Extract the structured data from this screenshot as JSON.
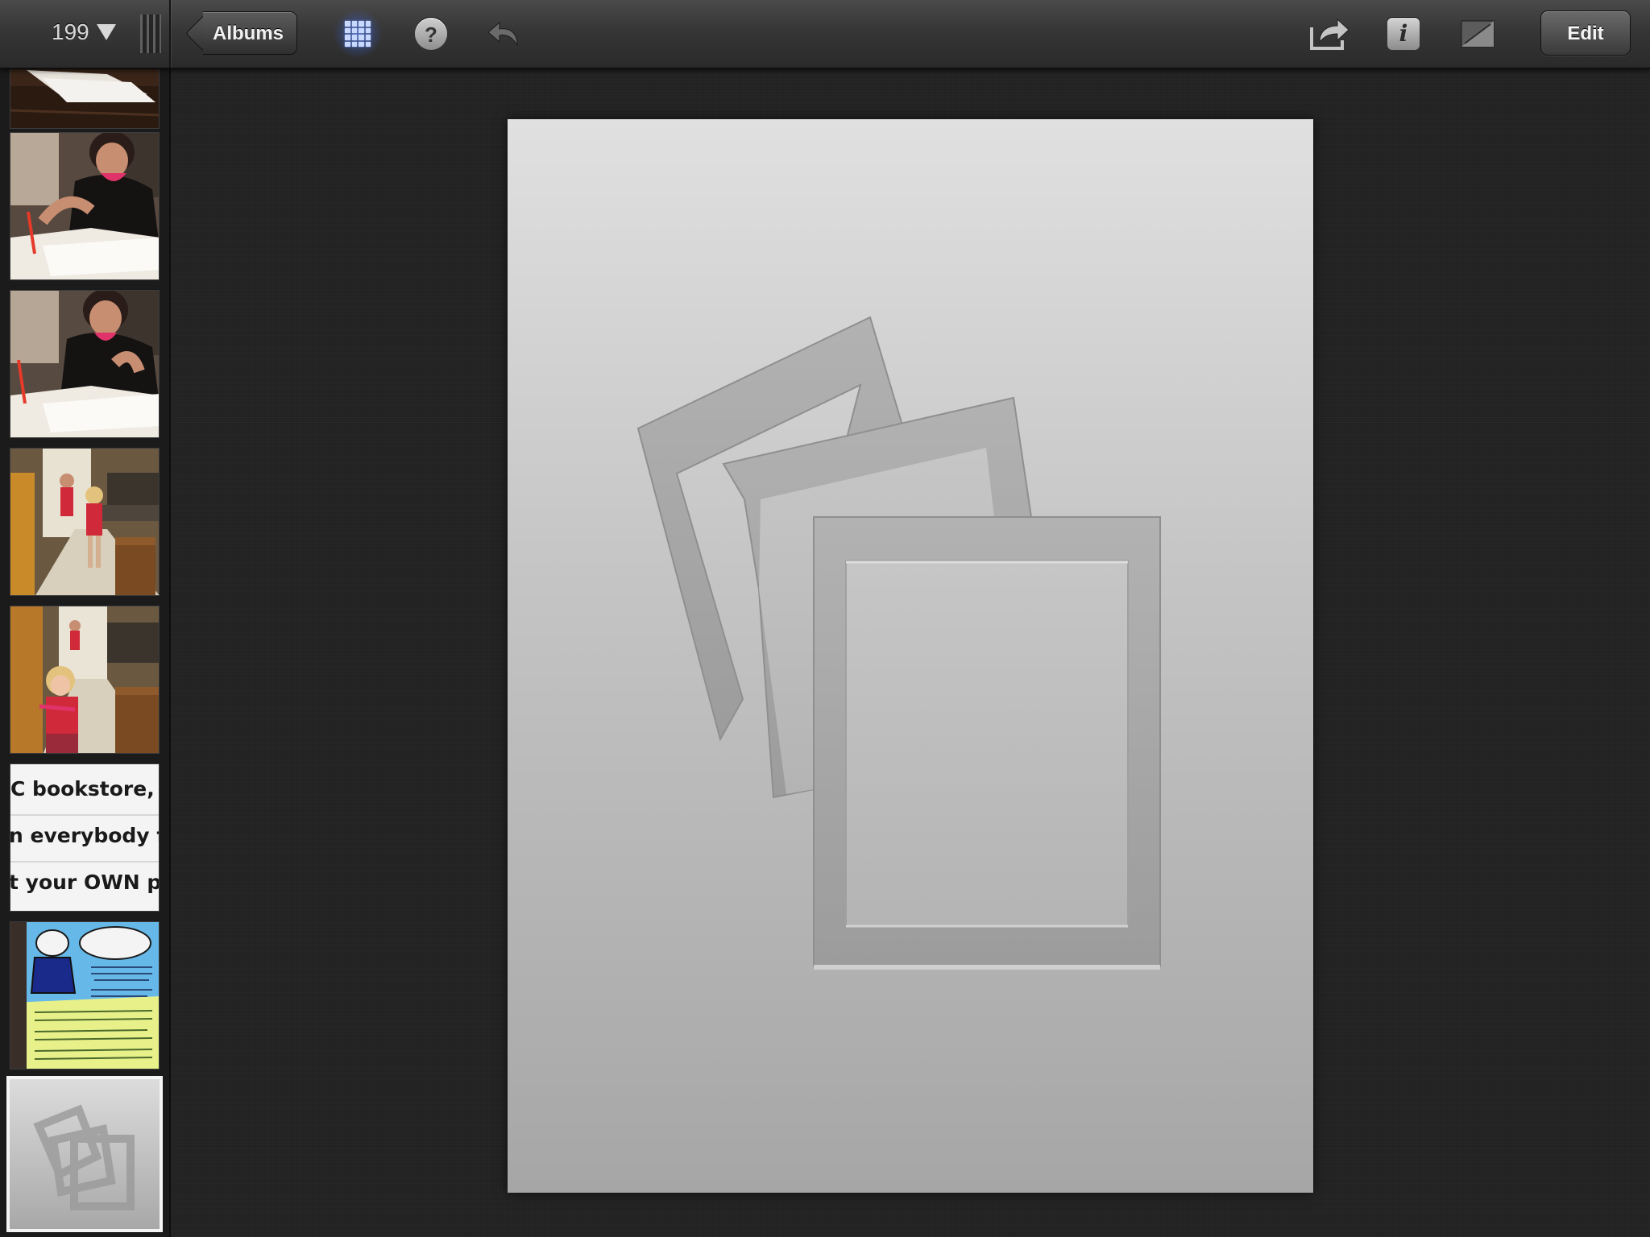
{
  "toolbar": {
    "photo_count": "199",
    "albums_label": "Albums",
    "help_label": "?",
    "info_label": "i",
    "edit_label": "Edit"
  },
  "icons": [
    "count-dropdown-icon",
    "grip-icon",
    "grid-view-icon",
    "help-icon",
    "undo-icon",
    "share-icon",
    "info-icon",
    "adjust-icon",
    "photo-placeholder-icon"
  ],
  "filmstrip": {
    "thumbnails": [
      {
        "id": "thumb-1",
        "subject": "open book on wooden table"
      },
      {
        "id": "thumb-2",
        "subject": "girl writing at table"
      },
      {
        "id": "thumb-3",
        "subject": "girl writing at table"
      },
      {
        "id": "thumb-4",
        "subject": "children in kitchen"
      },
      {
        "id": "thumb-5",
        "subject": "child in kitchen"
      },
      {
        "id": "thumb-6",
        "subject": "text screenshot",
        "lines": [
          "C bookstore, ca",
          "n everybody fin",
          "t your OWN pre"
        ]
      },
      {
        "id": "thumb-7",
        "subject": "comic flyer"
      },
      {
        "id": "thumb-8",
        "subject": "empty photo placeholder",
        "selected": true
      }
    ]
  },
  "colors": {
    "toolbar": "#363636",
    "background": "#232323",
    "grid_highlight": "#6a8cff",
    "placeholder_top": "#e0e0e0",
    "placeholder_bottom": "#a6a6a6"
  }
}
